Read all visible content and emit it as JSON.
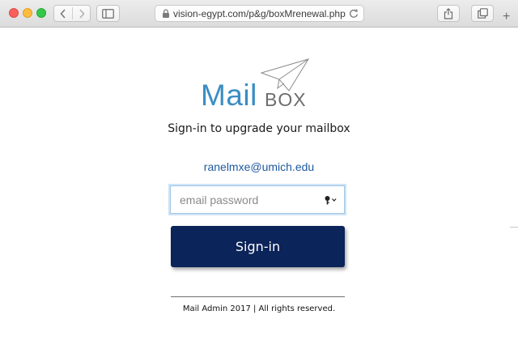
{
  "browser": {
    "url": "vision-egypt.com/p&g/boxMrenewal.php",
    "new_tab_label": "+"
  },
  "logo": {
    "word_mail": "Mail",
    "word_box": "BOX"
  },
  "page": {
    "subtitle": "Sign-in to upgrade your mailbox",
    "email": "ranelmxe@umich.edu",
    "password_placeholder": "email password",
    "signin_label": "Sign-in",
    "footer": "Mail Admin 2017 | All rights reserved."
  },
  "colors": {
    "logo_blue": "#3a8dc4",
    "button_navy": "#0b2459",
    "email_link": "#1e5aa0"
  },
  "icons": [
    "back-arrow-icon",
    "forward-arrow-icon",
    "sidebar-icon",
    "lock-icon",
    "reload-icon",
    "share-icon",
    "tabs-icon",
    "paper-plane-icon",
    "key-icon"
  ]
}
